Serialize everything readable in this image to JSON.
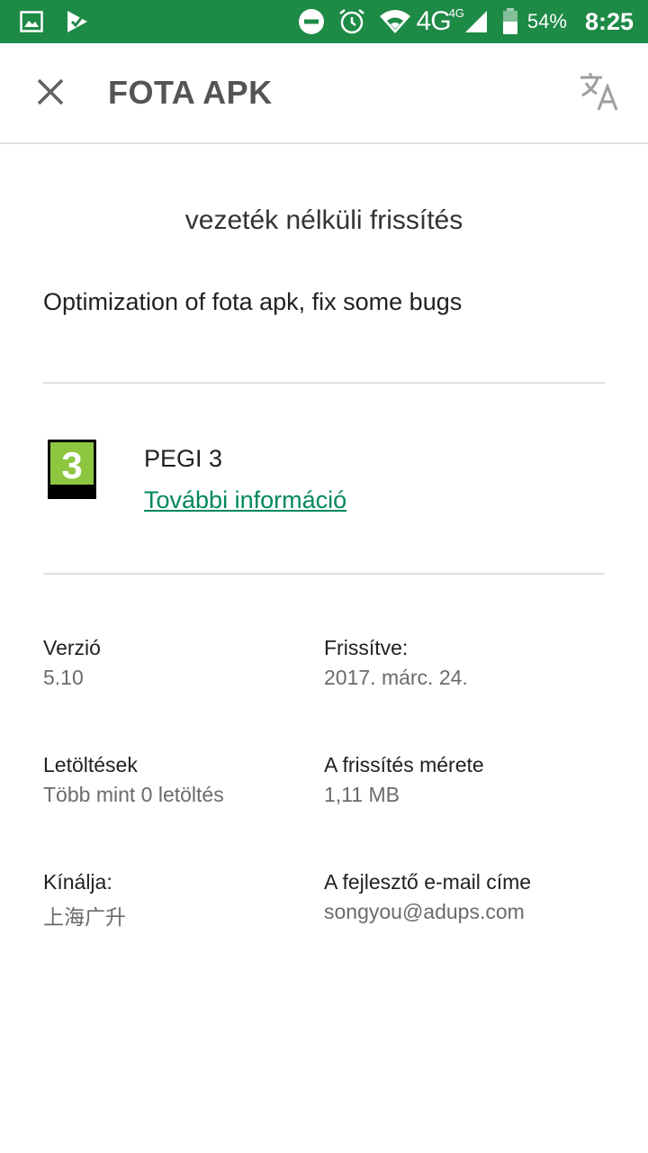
{
  "status_bar": {
    "background": "#1d8a46",
    "left_icons": [
      "image-icon",
      "play-store-check-icon"
    ],
    "right_icons": [
      "do-not-disturb-icon",
      "alarm-icon",
      "wifi-icon",
      "signal-icon",
      "battery-icon"
    ],
    "network_label": "4G",
    "network_sup": "4G",
    "battery": "54%",
    "time": "8:25"
  },
  "app_bar": {
    "title": "FOTA APK",
    "close_icon": "close-icon",
    "translate_icon": "translate-icon"
  },
  "content": {
    "subtitle": "vezeték nélküli frissítés",
    "description": "Optimization of fota apk, fix some bugs",
    "rating": {
      "badge_number": "3",
      "badge_color": "#8dc63f",
      "label": "PEGI 3",
      "more_info": "További információ"
    },
    "info": {
      "version_label": "Verzió",
      "version_value": "5.10",
      "updated_label": "Frissítve:",
      "updated_value": "2017. márc. 24.",
      "downloads_label": "Letöltések",
      "downloads_value": "Több mint 0 letöltés",
      "update_size_label": "A frissítés mérete",
      "update_size_value": "1,11 MB",
      "offered_by_label": "Kínálja:",
      "offered_by_value": "上海广升",
      "developer_email_label": "A fejlesztő e-mail címe",
      "developer_email_value": "songyou@adups.com"
    }
  },
  "colors": {
    "accent_link": "#01875f",
    "status_bar": "#1d8a46"
  }
}
